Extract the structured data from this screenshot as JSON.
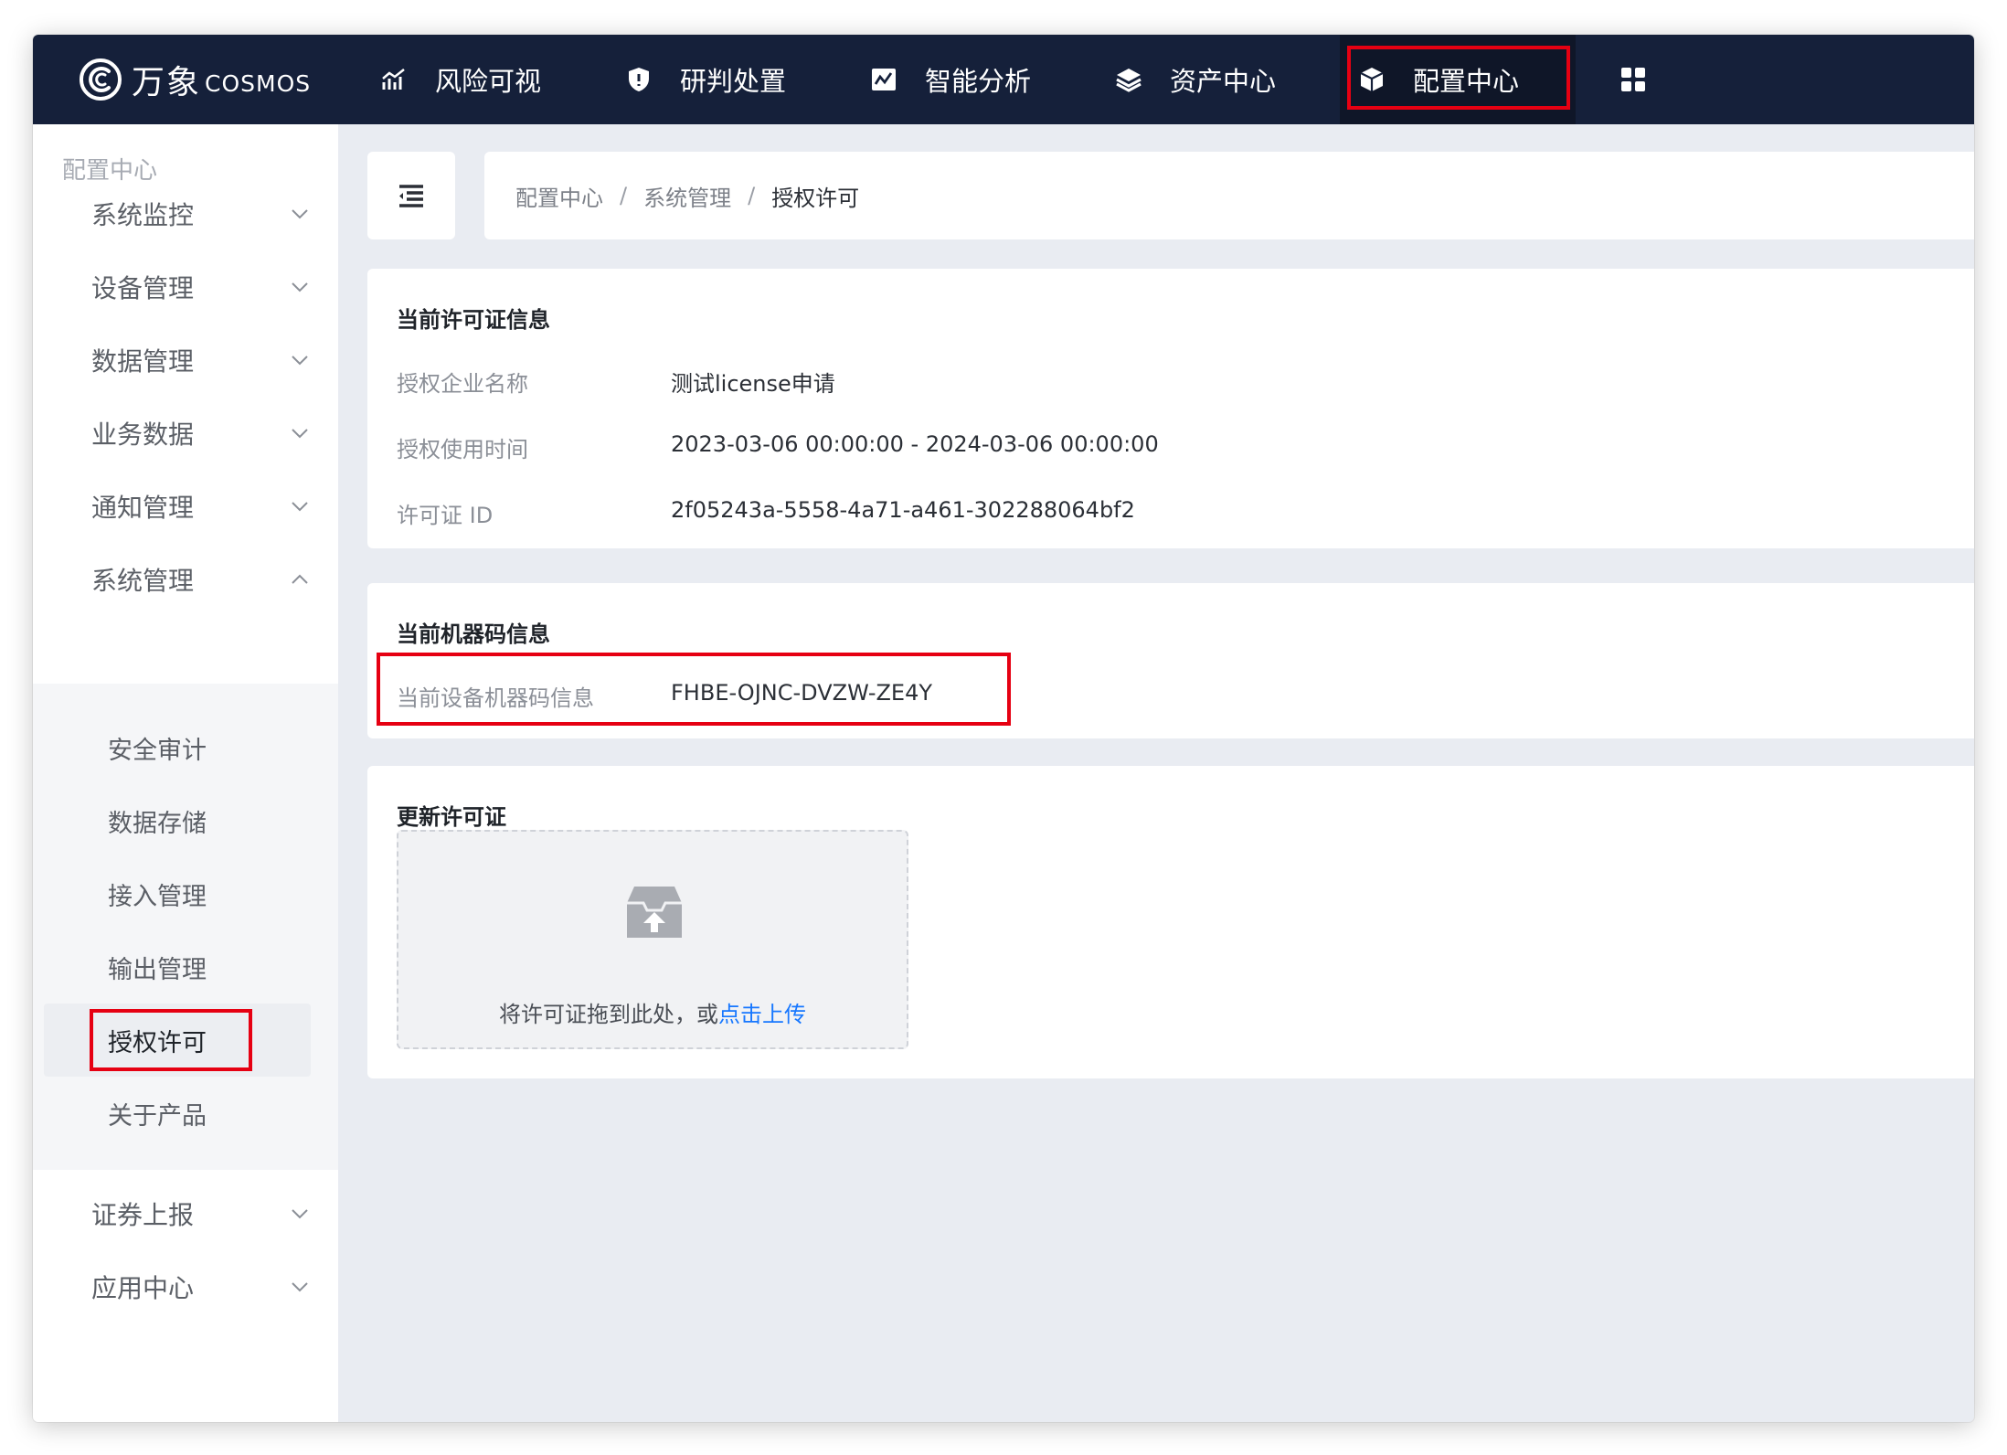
{
  "brand": {
    "name_cn": "万象",
    "name_en": "COSMOS"
  },
  "nav": {
    "items": [
      {
        "label": "风险可视",
        "icon": "chart-line-icon"
      },
      {
        "label": "研判处置",
        "icon": "shield-icon"
      },
      {
        "label": "智能分析",
        "icon": "analytics-icon"
      },
      {
        "label": "资产中心",
        "icon": "layers-icon"
      },
      {
        "label": "配置中心",
        "icon": "cube-icon",
        "active": true
      }
    ],
    "apps_icon": "grid-apps-icon"
  },
  "sidebar": {
    "title": "配置中心",
    "menu": [
      {
        "label": "系统监控"
      },
      {
        "label": "设备管理"
      },
      {
        "label": "数据管理"
      },
      {
        "label": "业务数据"
      },
      {
        "label": "通知管理"
      },
      {
        "label": "系统管理",
        "expanded": true
      }
    ],
    "submenu": [
      {
        "label": "安全审计"
      },
      {
        "label": "数据存储"
      },
      {
        "label": "接入管理"
      },
      {
        "label": "输出管理"
      },
      {
        "label": "授权许可",
        "active": true
      },
      {
        "label": "关于产品"
      }
    ],
    "menu_after": [
      {
        "label": "证券上报"
      },
      {
        "label": "应用中心"
      }
    ]
  },
  "breadcrumb": {
    "items": [
      "配置中心",
      "系统管理",
      "授权许可"
    ],
    "separator": "/"
  },
  "license_card": {
    "title": "当前许可证信息",
    "rows": [
      {
        "label": "授权企业名称",
        "value": "测试license申请"
      },
      {
        "label": "授权使用时间",
        "value": "2023-03-06 00:00:00 - 2024-03-06 00:00:00"
      },
      {
        "label": "许可证 ID",
        "value": "2f05243a-5558-4a71-a461-302288064bf2"
      }
    ]
  },
  "machine_card": {
    "title": "当前机器码信息",
    "label": "当前设备机器码信息",
    "value": "FHBE-OJNC-DVZW-ZE4Y"
  },
  "update_card": {
    "title": "更新许可证",
    "drop_text": "将许可证拖到此处，或",
    "link_text": "点击上传"
  },
  "colors": {
    "nav_bg": "#15203a",
    "highlight_red": "#e60012",
    "link_blue": "#1677ff",
    "page_bg": "#e9ecf2"
  }
}
